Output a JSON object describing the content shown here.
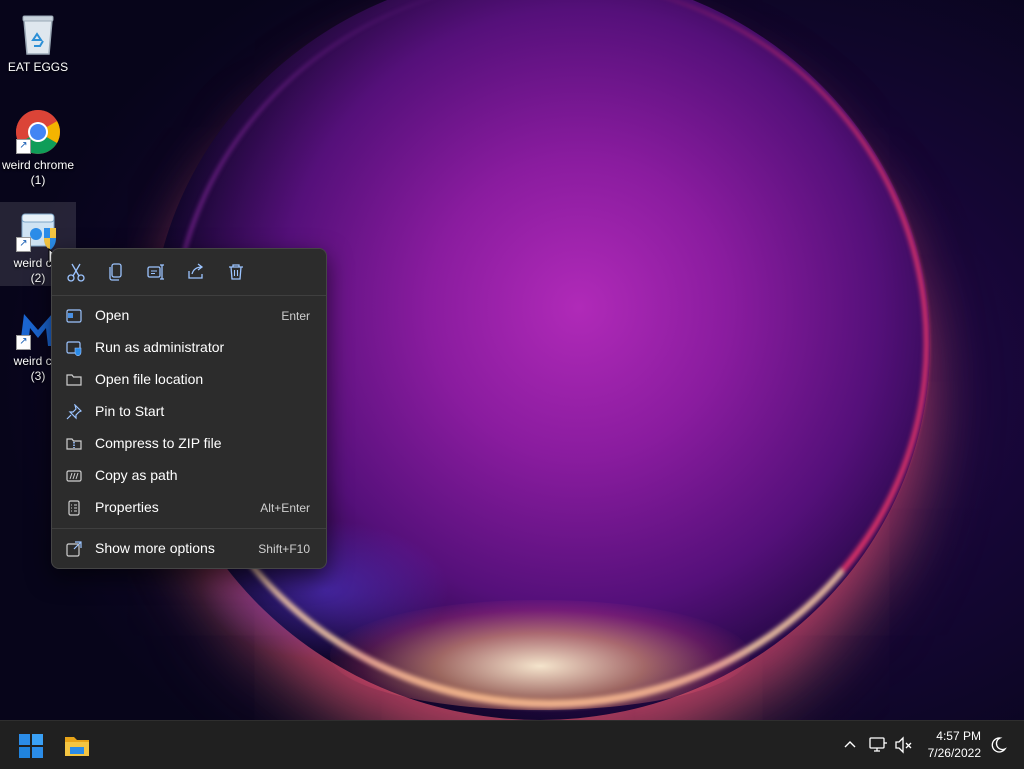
{
  "desktop": {
    "icons": [
      {
        "label": "EAT EGGS"
      },
      {
        "label": "weird chrome",
        "sub": "(1)"
      },
      {
        "label": "weird chr",
        "sub": "(2)"
      },
      {
        "label": "weird chr",
        "sub": "(3)"
      }
    ]
  },
  "context_menu": {
    "toolbar": [
      {
        "icon": "cut-icon"
      },
      {
        "icon": "copy-icon"
      },
      {
        "icon": "rename-icon"
      },
      {
        "icon": "share-icon"
      },
      {
        "icon": "delete-icon"
      }
    ],
    "items": [
      {
        "label": "Open",
        "shortcut": "Enter",
        "icon": "open-icon"
      },
      {
        "label": "Run as administrator",
        "shortcut": "",
        "icon": "run-as-admin-icon"
      },
      {
        "label": "Open file location",
        "shortcut": "",
        "icon": "folder-icon"
      },
      {
        "label": "Pin to Start",
        "shortcut": "",
        "icon": "pin-icon"
      },
      {
        "label": "Compress to ZIP file",
        "shortcut": "",
        "icon": "zip-icon"
      },
      {
        "label": "Copy as path",
        "shortcut": "",
        "icon": "copy-path-icon"
      },
      {
        "label": "Properties",
        "shortcut": "Alt+Enter",
        "icon": "properties-icon"
      },
      {
        "label": "Show more options",
        "shortcut": "Shift+F10",
        "icon": "more-options-icon"
      }
    ]
  },
  "taskbar": {
    "time": "4:57 PM",
    "date": "7/26/2022"
  },
  "colors": {
    "menu_bg": "#2c2c2c",
    "taskbar_bg": "#202020",
    "windows_blue": "#2b8ce8",
    "folder_yellow": "#f4c542"
  }
}
